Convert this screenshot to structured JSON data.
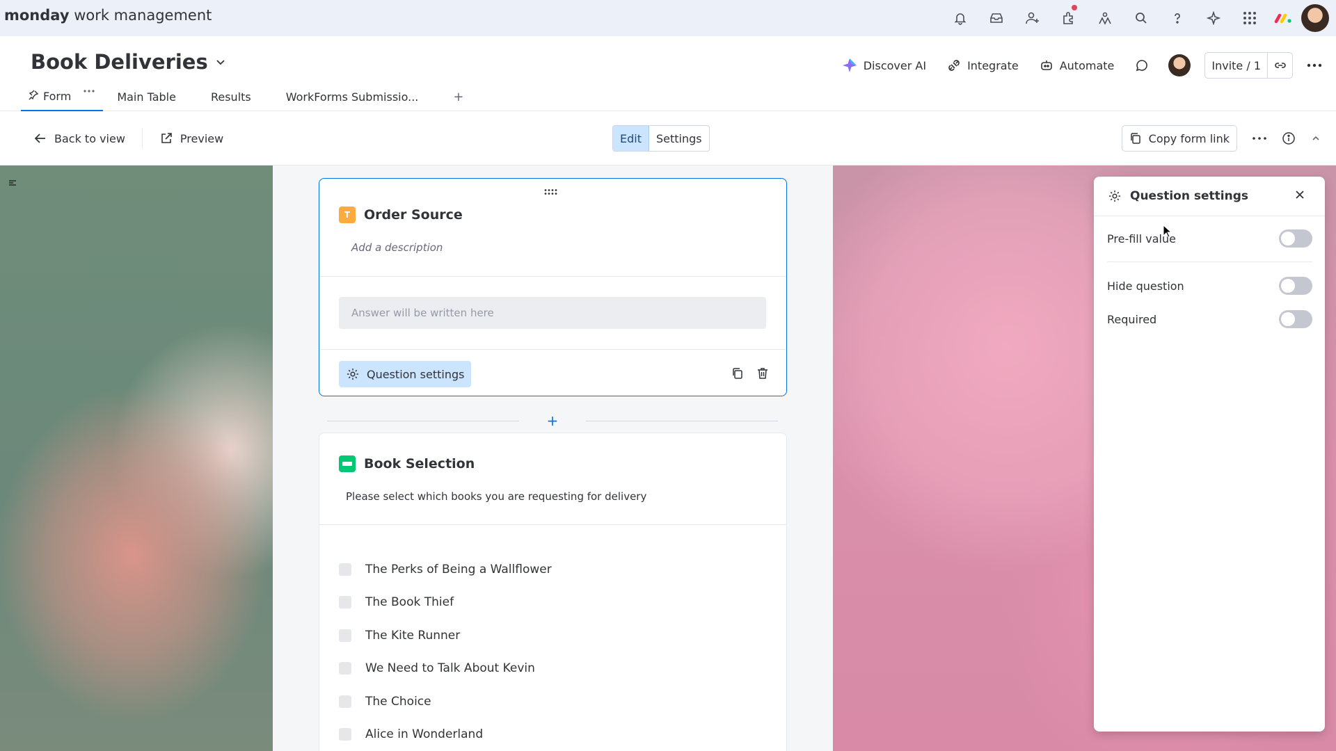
{
  "app": {
    "brand_bold": "monday",
    "brand_rest": " work management"
  },
  "board": {
    "title": "Book Deliveries",
    "actions": {
      "discover_ai": "Discover AI",
      "integrate": "Integrate",
      "automate": "Automate",
      "invite": "Invite / 1"
    }
  },
  "tabs": [
    {
      "label": "Form"
    },
    {
      "label": "Main Table"
    },
    {
      "label": "Results"
    },
    {
      "label": "WorkForms Submissio..."
    }
  ],
  "toolbar": {
    "back": "Back to view",
    "preview": "Preview",
    "edit": "Edit",
    "settings": "Settings",
    "copy_link": "Copy form link"
  },
  "form": {
    "q1": {
      "title": "Order Source",
      "badge": "T",
      "badge_color": "#fdab3d",
      "description_placeholder": "Add a description",
      "answer_placeholder": "Answer will be written here",
      "settings_button": "Question settings"
    },
    "q2": {
      "title": "Book Selection",
      "badge_color": "#00c875",
      "description": "Please select which books you are requesting for delivery",
      "options": [
        "The Perks of Being a Wallflower",
        "The Book Thief",
        "The Kite Runner",
        "We Need to Talk About Kevin",
        "The Choice",
        "Alice in Wonderland"
      ]
    }
  },
  "panel": {
    "title": "Question settings",
    "rows": [
      {
        "label": "Pre-fill value",
        "on": false
      },
      {
        "label": "Hide question",
        "on": false
      },
      {
        "label": "Required",
        "on": false
      }
    ]
  },
  "colors": {
    "accent": "#0073ea",
    "selected_bg": "#cce5ff"
  }
}
